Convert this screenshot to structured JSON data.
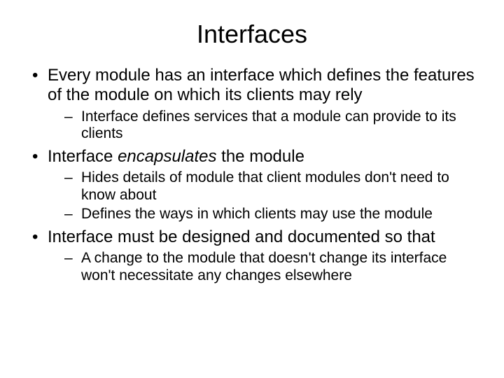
{
  "title": "Interfaces",
  "b1": "Every module has an interface which defines the features of the module on which its clients may rely",
  "b1s1": "Interface defines services that a module can provide to its clients",
  "b2a": "Interface ",
  "b2em": "encapsulates",
  "b2b": " the module",
  "b2s1": "Hides details of module that client modules don't need to know about",
  "b2s2": "Defines the ways in which clients may use the module",
  "b3": "Interface must be designed and documented so that",
  "b3s1": "A change to the module that doesn't change its interface won't necessitate any changes elsewhere"
}
